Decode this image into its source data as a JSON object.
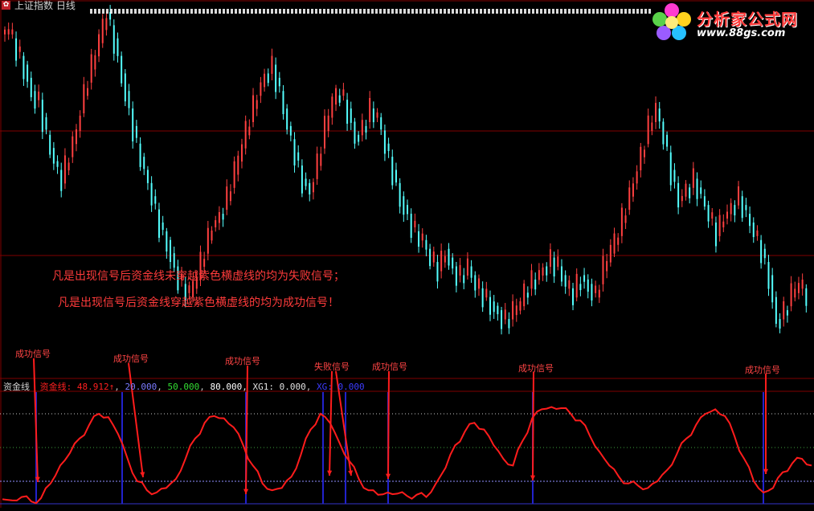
{
  "window": {
    "title": "上证指数 日线",
    "sys_icon": "app-menu-icon"
  },
  "logo": {
    "name": "分析家公式网",
    "url": "www.88gs.com",
    "icon": "flower-logo-icon"
  },
  "notes": {
    "fail_rule": "凡是出现信号后资金线未穿越紫色横虚线的均为失败信号；",
    "success_rule": "凡是出现信号后资金线穿越紫色横虚线的均为成功信号！"
  },
  "signals": [
    {
      "label": "成功信号"
    },
    {
      "label": "成功信号"
    },
    {
      "label": "成功信号"
    },
    {
      "label": "失败信号"
    },
    {
      "label": "成功信号"
    },
    {
      "label": "成功信号"
    },
    {
      "label": "成功信号"
    }
  ],
  "indicator": {
    "name": "资金线",
    "legend": [
      {
        "text": "资金线: 48.912↑",
        "color": "#ff2020"
      },
      {
        "text": ", ",
        "color": "#c0c0c0"
      },
      {
        "text": "20.000",
        "color": "#7a7aff"
      },
      {
        "text": ", ",
        "color": "#c0c0c0"
      },
      {
        "text": "50.000",
        "color": "#33dd33"
      },
      {
        "text": ", ",
        "color": "#c0c0c0"
      },
      {
        "text": "80.000",
        "color": "#ffffff"
      },
      {
        "text": ", XG1: 0.000",
        "color": "#e0e0e0"
      },
      {
        "text": ", ",
        "color": "#c0c0c0"
      },
      {
        "text": "XG: 0.000",
        "color": "#3c3cff"
      }
    ]
  },
  "colors": {
    "background": "#000000",
    "up_candle": "#ff4040",
    "down_candle": "#54ffff",
    "gridline": "#800000",
    "fund_line": "#ff1c1c",
    "signal_bar": "#2222cc",
    "level_80": "#c8c8c8",
    "level_50": "#40a040",
    "level_20": "#9090ff"
  },
  "chart_data": [
    {
      "type": "candlestick",
      "title": "上证指数 日线",
      "close": [
        3.3,
        3.1,
        2.9,
        2.6,
        2.5,
        2.1,
        1.8,
        1.6,
        1.9,
        2.2,
        2.6,
        2.9,
        3.2,
        3.5,
        3.2,
        2.8,
        2.4,
        2.0,
        1.7,
        1.4,
        1.1,
        0.9,
        0.6,
        0.4,
        0.3,
        0.5,
        0.8,
        1.1,
        1.2,
        1.4,
        1.7,
        2.0,
        2.3,
        2.6,
        2.8,
        2.9,
        2.6,
        2.2,
        1.9,
        1.6,
        1.5,
        1.8,
        2.2,
        2.5,
        2.6,
        2.4,
        2.1,
        2.2,
        2.4,
        2.3,
        2.0,
        1.7,
        1.4,
        1.2,
        1.0,
        0.9,
        0.7,
        0.6,
        0.8,
        0.6,
        0.5,
        0.6,
        0.4,
        0.3,
        0.2,
        0.1,
        0.0,
        0.1,
        0.2,
        0.4,
        0.5,
        0.6,
        0.7,
        0.6,
        0.4,
        0.3,
        0.5,
        0.4,
        0.3,
        0.6,
        0.8,
        1.0,
        1.3,
        1.6,
        1.9,
        2.2,
        2.4,
        2.1,
        1.7,
        1.4,
        1.5,
        1.6,
        1.4,
        1.2,
        1.0,
        1.2,
        1.3,
        1.4,
        1.2,
        1.0,
        0.8,
        0.5,
        0.0,
        0.1,
        0.3,
        0.4,
        0.3
      ]
    },
    {
      "type": "line",
      "title": "资金线",
      "series": [
        {
          "name": "资金线",
          "values": [
            4,
            3,
            6,
            2,
            5,
            18,
            34,
            45,
            58,
            70,
            80,
            77,
            62,
            40,
            20,
            12,
            10,
            14,
            22,
            40,
            58,
            72,
            78,
            76,
            68,
            52,
            34,
            18,
            12,
            14,
            24,
            44,
            66,
            80,
            72,
            54,
            38,
            22,
            12,
            8,
            10,
            9,
            7,
            8,
            6,
            18,
            32,
            52,
            64,
            72,
            66,
            52,
            40,
            34,
            56,
            76,
            84,
            86,
            85,
            80,
            74,
            60,
            46,
            34,
            24,
            18,
            16,
            14,
            20,
            30,
            44,
            58,
            70,
            80,
            84,
            78,
            60,
            40,
            20,
            10,
            14,
            28,
            36,
            40,
            34
          ]
        }
      ],
      "levels": [
        20,
        50,
        80
      ],
      "ylim": [
        0,
        100
      ]
    }
  ]
}
